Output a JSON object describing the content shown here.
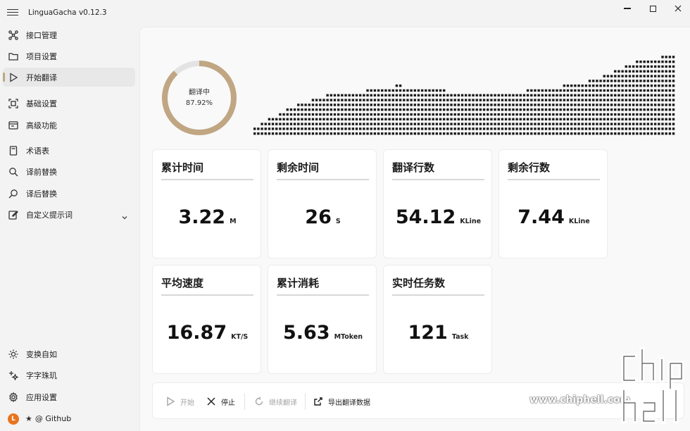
{
  "app": {
    "title": "LinguaGacha v0.12.3"
  },
  "sidebar": {
    "items": [
      {
        "label": "接口管理",
        "icon": "network-icon"
      },
      {
        "label": "项目设置",
        "icon": "folder-icon"
      },
      {
        "label": "开始翻译",
        "icon": "play-icon",
        "active": true
      },
      {
        "label": "基础设置",
        "icon": "settings-frame-icon"
      },
      {
        "label": "高级功能",
        "icon": "window-icon"
      },
      {
        "label": "术语表",
        "icon": "book-icon"
      },
      {
        "label": "译前替换",
        "icon": "search-icon"
      },
      {
        "label": "译后替换",
        "icon": "search-alt-icon"
      },
      {
        "label": "自定义提示词",
        "icon": "edit-icon"
      }
    ],
    "bottom": [
      {
        "label": "变换自如",
        "icon": "brightness-icon"
      },
      {
        "label": "字字珠玑",
        "icon": "sparkle-icon"
      },
      {
        "label": "应用设置",
        "icon": "gear-icon"
      },
      {
        "label": "@ Github",
        "avatar": "L",
        "star": "★"
      }
    ]
  },
  "progress": {
    "label": "翻译中",
    "percent_text": "87.92%",
    "fraction": 0.8792,
    "color": "#c0a682",
    "track": "#e3e3e3"
  },
  "cards": [
    {
      "title": "累计时间",
      "value": "3.22",
      "unit": "M"
    },
    {
      "title": "剩余时间",
      "value": "26",
      "unit": "S"
    },
    {
      "title": "翻译行数",
      "value": "54.12",
      "unit": "KLine"
    },
    {
      "title": "剩余行数",
      "value": "7.44",
      "unit": "KLine"
    },
    {
      "title": "平均速度",
      "value": "16.87",
      "unit": "KT/S"
    },
    {
      "title": "累计消耗",
      "value": "5.63",
      "unit": "MToken"
    },
    {
      "title": "实时任务数",
      "value": "121",
      "unit": "Task"
    }
  ],
  "toolbar": {
    "start": "开始",
    "stop": "停止",
    "resume": "继续翻译",
    "export": "导出翻译数据"
  },
  "watermark": {
    "text": "www.chiphell.com"
  },
  "wave_levels": [
    2,
    2,
    3,
    3,
    4,
    4,
    4,
    5,
    5,
    6,
    6,
    6,
    7,
    7,
    7,
    7,
    8,
    8,
    8,
    8,
    9,
    9,
    9,
    9,
    9,
    9,
    9,
    9,
    9,
    9,
    9,
    10,
    10,
    10,
    10,
    10,
    10,
    10,
    10,
    11,
    11,
    10,
    10,
    10,
    10,
    10,
    10,
    10,
    10,
    10,
    10,
    10,
    10,
    9,
    9,
    9,
    9,
    9,
    9,
    9,
    9,
    9,
    9,
    9,
    9,
    9,
    9,
    9,
    9,
    9,
    9,
    9,
    9,
    9,
    9,
    10,
    10,
    10,
    10,
    10,
    10,
    10,
    10,
    10,
    10,
    11,
    11,
    11,
    11,
    11,
    11,
    11,
    12,
    12,
    12,
    12,
    13,
    13,
    13,
    14,
    14,
    14,
    15,
    15,
    15,
    16,
    16,
    16,
    16,
    16,
    16,
    16,
    17,
    17,
    17,
    17
  ]
}
